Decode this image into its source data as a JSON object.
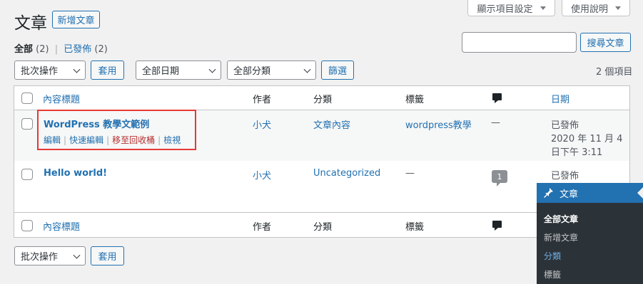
{
  "page": {
    "title": "文章",
    "add_new": "新增文章"
  },
  "top_tabs": {
    "screen_options": "顯示項目設定",
    "help": "使用說明"
  },
  "filters_links": {
    "all": "全部",
    "all_count": "(2)",
    "sep": "|",
    "published": "已發佈",
    "published_count": "(2)"
  },
  "search": {
    "value": "",
    "button": "搜尋文章"
  },
  "bulk_top": {
    "selected": "批次操作",
    "apply": "套用"
  },
  "date_filter": {
    "selected": "全部日期"
  },
  "category_filter": {
    "selected": "全部分類"
  },
  "filter_button": "篩選",
  "item_count": "2 個項目",
  "columns": {
    "title": "內容標題",
    "author": "作者",
    "categories": "分類",
    "tags": "標籤",
    "date": "日期"
  },
  "posts": [
    {
      "title": "WordPress 教學文範例",
      "author": "小犬",
      "category": "文章內容",
      "tags": "wordpress教學",
      "comments": "—",
      "status": "已發佈",
      "date_line1": "2020 年 11 月 4",
      "date_line2": "日下午 3:11",
      "actions": {
        "edit": "編輯",
        "quick_edit": "快速編輯",
        "trash": "移至回收桶",
        "view": "檢視"
      }
    },
    {
      "title": "Hello world!",
      "author": "小犬",
      "category": "Uncategorized",
      "tags": "—",
      "comments": "1",
      "status": "已發佈"
    }
  ],
  "bulk_bottom": {
    "selected": "批次操作",
    "apply": "套用"
  },
  "flyout": {
    "header": "文章",
    "items": [
      "全部文章",
      "新增文章",
      "分類",
      "標籤"
    ]
  },
  "colors": {
    "link": "#2271b1",
    "trash": "#b32d2e",
    "highlight_box": "#e53935",
    "flyout_bg": "#2c3338",
    "flyout_header": "#2271b1"
  }
}
